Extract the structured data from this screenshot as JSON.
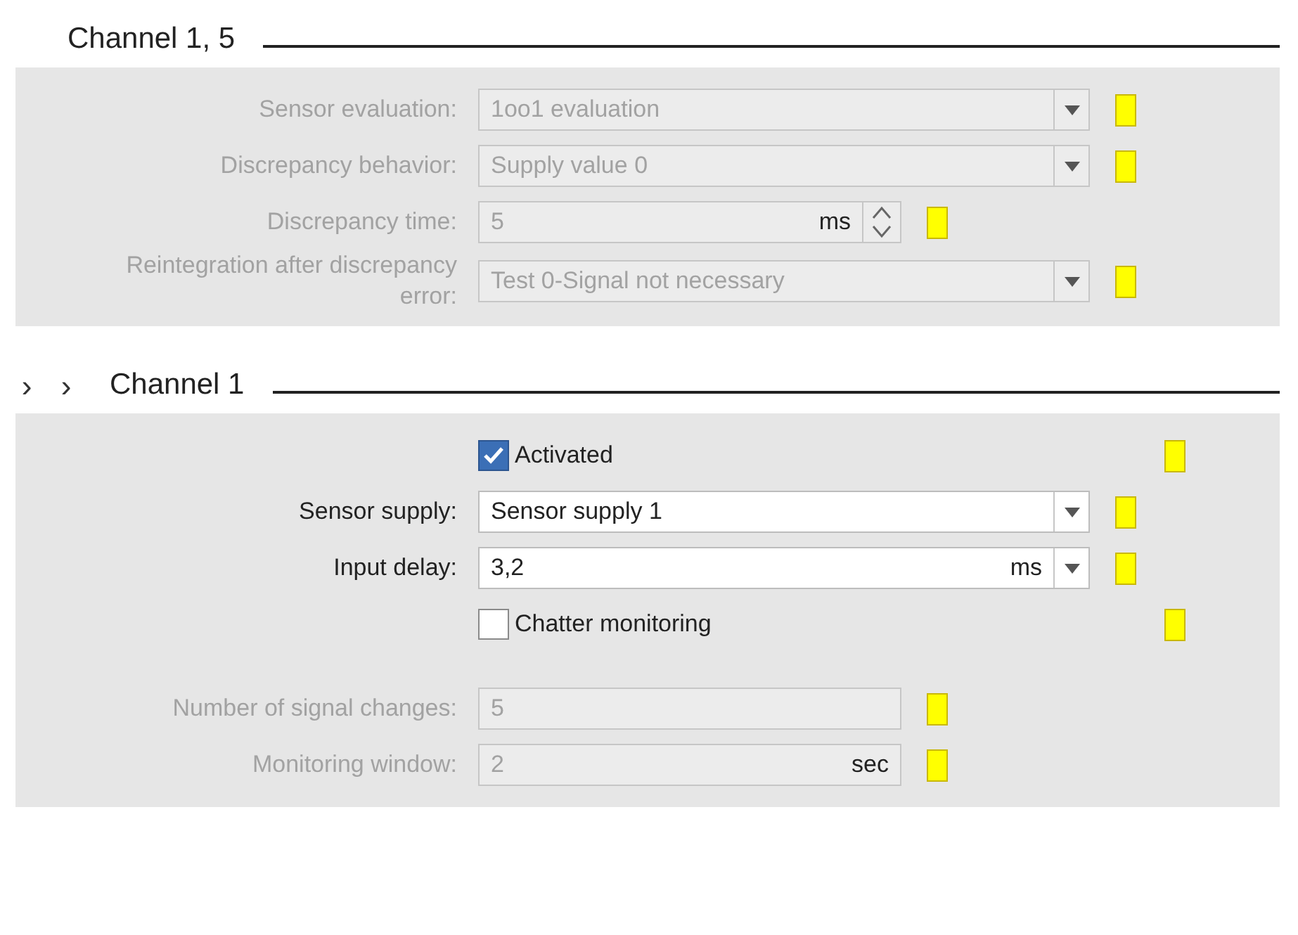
{
  "sections": [
    {
      "title": "Channel 1, 5",
      "rows": [
        {
          "kind": "dropdown",
          "label": "Sensor evaluation:",
          "value": "1oo1 evaluation",
          "disabled": true
        },
        {
          "kind": "dropdown",
          "label": "Discrepancy behavior:",
          "value": "Supply value 0",
          "disabled": true
        },
        {
          "kind": "spin",
          "label": "Discrepancy time:",
          "value": "5",
          "unit": "ms",
          "disabled": true
        },
        {
          "kind": "dropdown",
          "label": "Reintegration after discrepancy error:",
          "value": "Test 0-Signal not necessary",
          "disabled": true
        }
      ]
    },
    {
      "title": "Channel 1",
      "chevrons": [
        "›",
        "›"
      ],
      "rows": [
        {
          "kind": "checkbox",
          "label": "Activated",
          "checked": true,
          "disabled": false
        },
        {
          "kind": "dropdown",
          "label": "Sensor supply:",
          "value": "Sensor supply 1",
          "disabled": false
        },
        {
          "kind": "unit-dropdown",
          "label": "Input delay:",
          "value": "3,2",
          "unit": "ms",
          "disabled": false
        },
        {
          "kind": "checkbox",
          "label": "Chatter monitoring",
          "checked": false,
          "disabled": false
        },
        {
          "kind": "text",
          "label": "Number of signal changes:",
          "value": "5",
          "disabled": true,
          "gap_before": true
        },
        {
          "kind": "text",
          "label": "Monitoring window:",
          "value": "2",
          "unit": "sec",
          "disabled": true
        }
      ]
    }
  ]
}
